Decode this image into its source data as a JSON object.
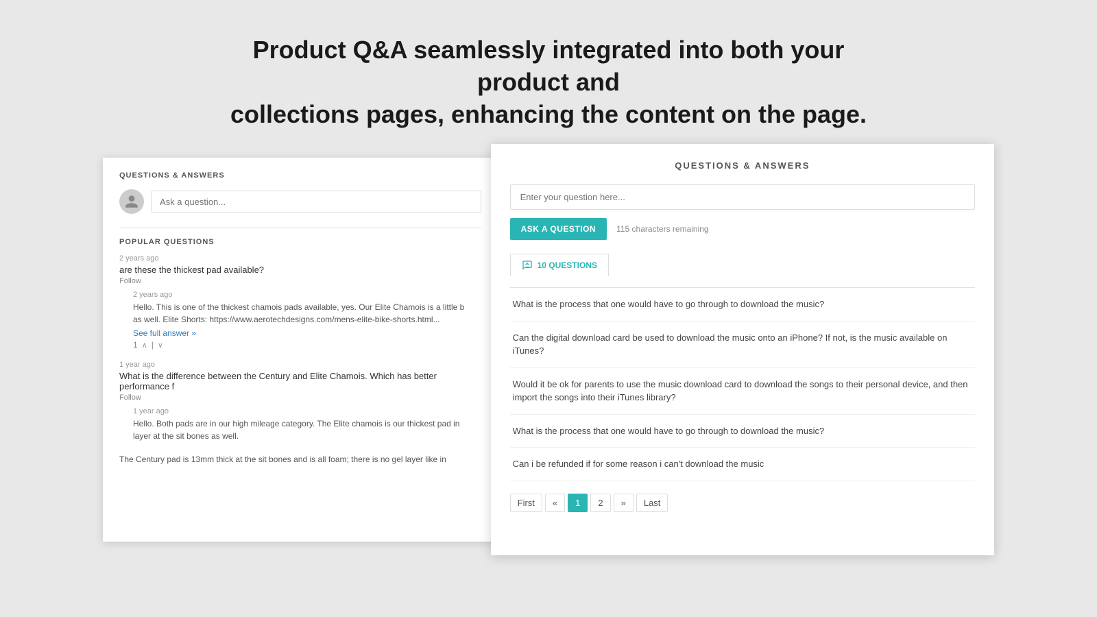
{
  "headline": {
    "line1": "Product Q&A seamlessly integrated into both your  product and",
    "line2": "collections pages, enhancing the content on the page."
  },
  "left_panel": {
    "header": "QUESTIONS & ANSWERS",
    "ask_placeholder": "Ask a question...",
    "popular_questions_label": "POPULAR QUESTIONS",
    "questions": [
      {
        "meta": "2 years ago",
        "text": "are these the thickest pad available?",
        "follow": "Follow",
        "answer": {
          "meta": "2 years ago",
          "text": "Hello. This is one of the thickest chamois pads available, yes. Our Elite Chamois is a little b",
          "text2": "as well. Elite Shorts: https://www.aerotechdesigns.com/mens-elite-bike-shorts.html...",
          "see_full": "See full answer »",
          "votes": "1"
        }
      },
      {
        "meta": "1 year ago",
        "text": "What is the difference between the Century and Elite Chamois. Which has better performance f",
        "follow": "Follow",
        "answer": {
          "meta": "1 year ago",
          "text": "Hello. Both pads are in our high mileage category. The Elite chamois is our thickest pad in",
          "text2": "layer at the sit bones as well.",
          "see_full": null,
          "votes": null
        }
      },
      {
        "meta": "",
        "text": "The Century pad is 13mm thick at the sit bones and is all foam; there is no gel layer like in",
        "follow": null,
        "answer": null
      }
    ]
  },
  "right_panel": {
    "header": "QUESTIONS & ANSWERS",
    "question_placeholder": "Enter your question here...",
    "ask_button": "ASK A QUESTION",
    "chars_remaining": "115 characters remaining",
    "questions_tab": "10 QUESTIONS",
    "questions": [
      "What is the process that one would have to go through to download the music?",
      "Can the digital download card be used to download the music onto an iPhone? If not, is the music available on iTunes?",
      "Would it be ok for parents to use the music download card to download the songs to their personal device, and then import the songs into their iTunes library?",
      "What is the process that one would have to go through to download the music?",
      "Can i be refunded if for some reason i can't download the music"
    ],
    "pagination": {
      "first": "First",
      "prev": "«",
      "page1": "1",
      "page2": "2",
      "next": "»",
      "last": "Last"
    }
  }
}
